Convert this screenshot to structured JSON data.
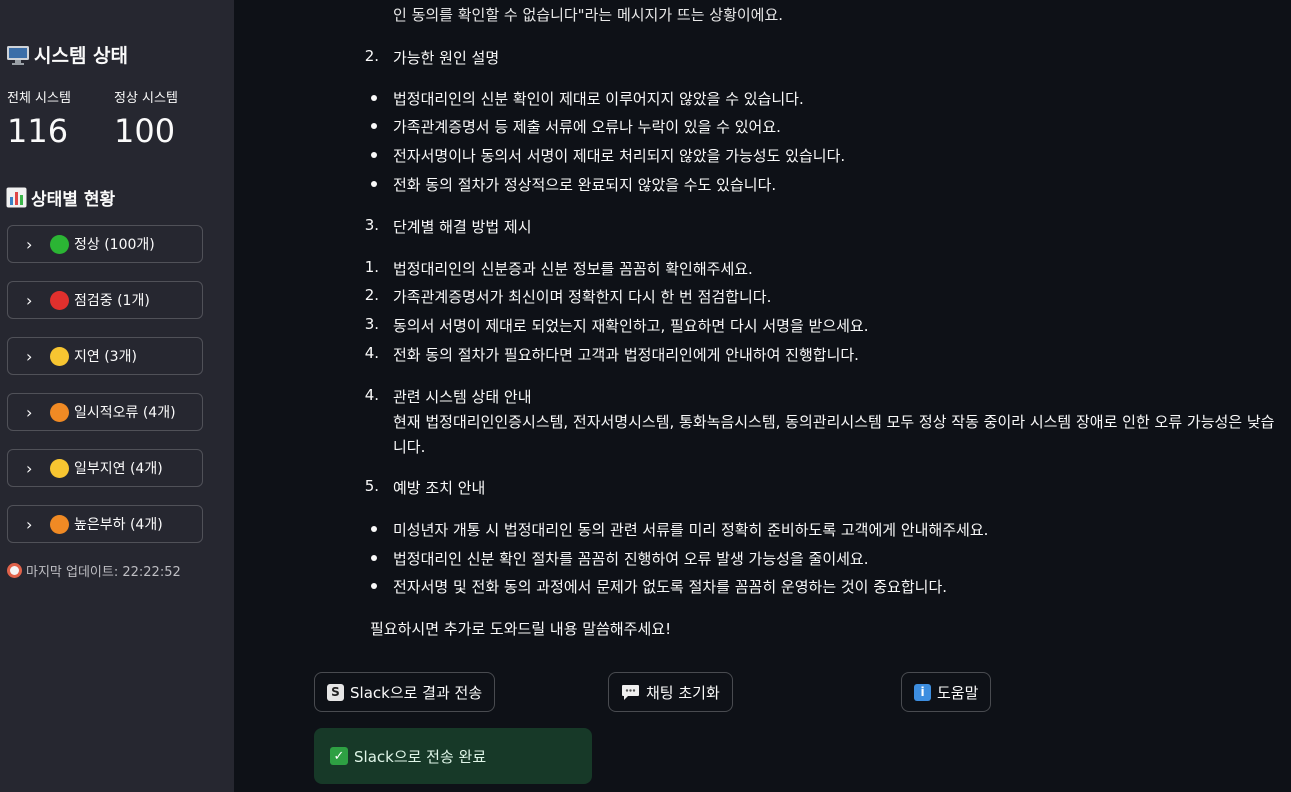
{
  "sidebar": {
    "title": "시스템 상태",
    "total_label": "전체 시스템",
    "total_value": "116",
    "normal_label": "정상 시스템",
    "normal_value": "100",
    "status_title": "상태별 현황",
    "expanders": [
      {
        "label": "정상 (100개)",
        "color": "#2bb534"
      },
      {
        "label": "점검중 (1개)",
        "color": "#e0302d"
      },
      {
        "label": "지연 (3개)",
        "color": "#f7c531"
      },
      {
        "label": "일시적오류 (4개)",
        "color": "#f08a24"
      },
      {
        "label": "일부지연 (4개)",
        "color": "#f7c531"
      },
      {
        "label": "높은부하 (4개)",
        "color": "#f08a24"
      }
    ],
    "last_update": "마지막 업데이트: 22:22:52"
  },
  "chat": {
    "top_partial": "인 동의를 확인할 수 없습니다\"라는 메시지가 뜨는 상황이에요.",
    "sec2_num": "2.",
    "sec2_title": "가능한 원인 설명",
    "causes": [
      "법정대리인의 신분 확인이 제대로 이루어지지 않았을 수 있습니다.",
      "가족관계증명서 등 제출 서류에 오류나 누락이 있을 수 있어요.",
      "전자서명이나 동의서 서명이 제대로 처리되지 않았을 가능성도 있습니다.",
      "전화 동의 절차가 정상적으로 완료되지 않았을 수도 있습니다."
    ],
    "sec3_num": "3.",
    "sec3_title": "단계별 해결 방법 제시",
    "steps": [
      {
        "num": "1.",
        "text": "법정대리인의 신분증과 신분 정보를 꼼꼼히 확인해주세요."
      },
      {
        "num": "2.",
        "text": "가족관계증명서가 최신이며 정확한지 다시 한 번 점검합니다."
      },
      {
        "num": "3.",
        "text": "동의서 서명이 제대로 되었는지 재확인하고, 필요하면 다시 서명을 받으세요."
      },
      {
        "num": "4.",
        "text": "전화 동의 절차가 필요하다면 고객과 법정대리인에게 안내하여 진행합니다."
      }
    ],
    "sec4_num": "4.",
    "sec4_title": "관련 시스템 상태 안내",
    "sec4_line1": "현재 법정대리인인증시스템, 전자서명시스템, 통화녹음시스템, 동의관리시스템 모두 정상 작동 중이라 시스템 장애로 인한 오류 가능성은 낮습",
    "sec4_line2": "니다.",
    "sec5_num": "5.",
    "sec5_title": "예방 조치 안내",
    "prevention": [
      "미성년자 개통 시 법정대리인 동의 관련 서류를 미리 정확히 준비하도록 고객에게 안내해주세요.",
      "법정대리인 신분 확인 절차를 꼼꼼히 진행하여 오류 발생 가능성을 줄이세요.",
      "전자서명 및 전화 동의 과정에서 문제가 없도록 절차를 꼼꼼히 운영하는 것이 중요합니다."
    ],
    "closing": "필요하시면 추가로 도와드릴 내용 말씀해주세요!"
  },
  "buttons": {
    "slack_send": "Slack으로 결과 전송",
    "reset_chat": "채팅 초기화",
    "help": "도움말"
  },
  "success_message": "Slack으로 전송 완료",
  "icons": {
    "title": "desktop-computer-icon",
    "status": "bar-chart-icon",
    "update": "alarm-clock-icon",
    "slack": "slack-s-icon",
    "chat": "speech-bubble-icon",
    "help": "info-icon",
    "success": "check-mark-icon"
  }
}
